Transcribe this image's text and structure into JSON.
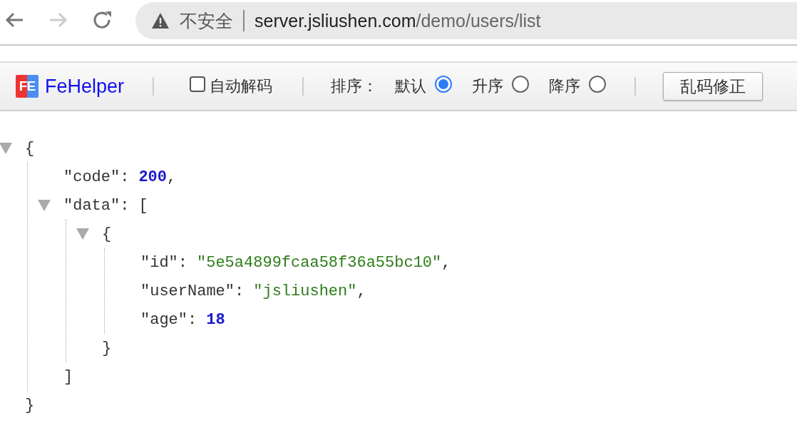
{
  "browser": {
    "security_label": "不安全",
    "url_host": "server.jsliushen.com",
    "url_path": "/demo/users/list"
  },
  "toolbar": {
    "logo": "FE",
    "brand": "FeHelper",
    "auto_decode": {
      "label": "自动解码",
      "checked": false
    },
    "sort_label": "排序：",
    "sort_options": [
      {
        "label": "默认",
        "selected": true
      },
      {
        "label": "升序",
        "selected": false
      },
      {
        "label": "降序",
        "selected": false
      }
    ],
    "fix_button": "乱码修正"
  },
  "json_view": {
    "kind": "container",
    "open": "{",
    "close": "}",
    "expanded": true,
    "children": [
      {
        "kind": "number",
        "key": "\"code\"",
        "colon": ":",
        "value": "200",
        "comma": ","
      },
      {
        "kind": "container",
        "key": "\"data\"",
        "colon": ":",
        "open": "[",
        "close": "]",
        "expanded": true,
        "children": [
          {
            "kind": "container",
            "open": "{",
            "close": "}",
            "expanded": true,
            "children": [
              {
                "kind": "string",
                "key": "\"id\"",
                "colon": ":",
                "value": "\"5e5a4899fcaa58f36a55bc10\"",
                "comma": ","
              },
              {
                "kind": "string",
                "key": "\"userName\"",
                "colon": ":",
                "value": "\"jsliushen\"",
                "comma": ","
              },
              {
                "kind": "number",
                "key": "\"age\"",
                "colon": ":",
                "value": "18"
              }
            ]
          }
        ]
      }
    ]
  }
}
